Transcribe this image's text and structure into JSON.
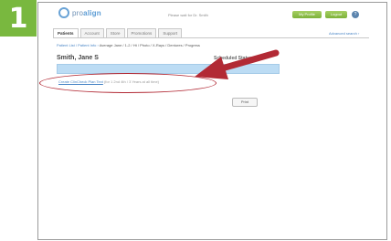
{
  "step_badge": {
    "number": "1",
    "color": "#79b83f"
  },
  "header": {
    "logo_text_light": "pro",
    "logo_text_bold": "align",
    "welcome_text": "Please wait for Dr. Smith",
    "button_a_label": "My Profile",
    "button_b_label": "Logout",
    "help_icon": "?"
  },
  "tabs": [
    {
      "label": "Patients",
      "active": true
    },
    {
      "label": "Account",
      "active": false
    },
    {
      "label": "Store",
      "active": false
    },
    {
      "label": "Promotions",
      "active": false
    },
    {
      "label": "Support",
      "active": false
    }
  ],
  "search_link": "Advanced search ›",
  "breadcrumb": {
    "link": "Patient List / Patient Info ›",
    "current": "Average Jane / 1-2 / Ht / Photo / X-Rays / Dentures / Progress"
  },
  "patient": {
    "name": "Smith, Jane S",
    "column_heading": "Scheduled Status"
  },
  "record": {
    "link_text": "Create ClinCheck Plan Text",
    "rest_text": "(for 1 2nd 4th / 3 Years at all time)"
  },
  "print_button": "Print",
  "colors": {
    "arrow": "#b22a35",
    "oval": "#b22a35",
    "link": "#4a86c6",
    "highlight": "#bcdcf4"
  }
}
